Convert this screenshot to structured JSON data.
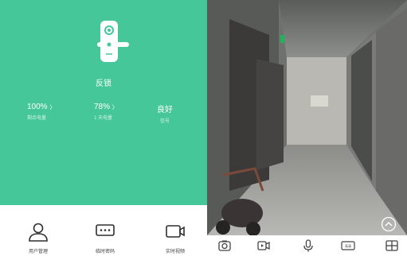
{
  "colors": {
    "accent": "#45c79a",
    "icon": "#2e2e2e"
  },
  "lock": {
    "state": "反锁",
    "icon": "smart-lock-icon"
  },
  "stats": [
    {
      "value": "100%",
      "chevron": "〉",
      "label": "剩余电量"
    },
    {
      "value": "78%",
      "chevron": "〉",
      "label": "1 天电量"
    },
    {
      "value": "良好",
      "chevron": "",
      "label": "信号"
    }
  ],
  "nav": [
    {
      "label": "用户管理",
      "icon": "user-icon"
    },
    {
      "label": "临时密码",
      "icon": "password-icon"
    },
    {
      "label": "实时视频",
      "icon": "video-camera-icon"
    }
  ],
  "camera": {
    "feed": "live-camera-feed"
  },
  "toolbar": {
    "icons": [
      "snapshot-icon",
      "record-icon",
      "microphone-icon",
      "quality-icon",
      "layout-icon"
    ],
    "quality_label": "高清"
  }
}
